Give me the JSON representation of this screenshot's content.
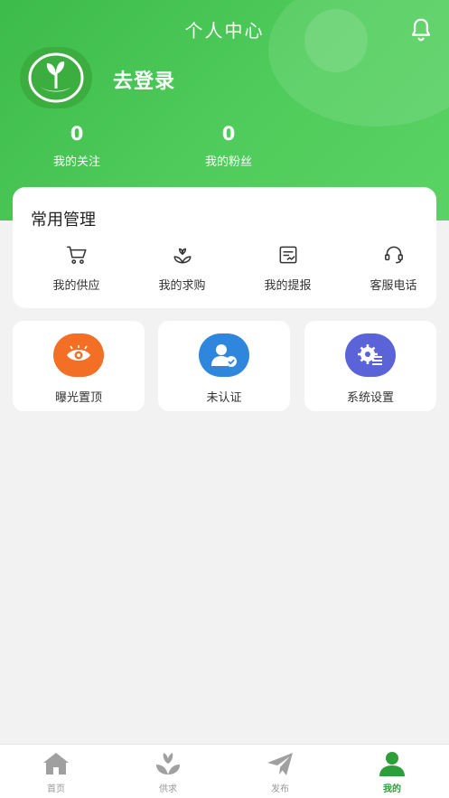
{
  "header": {
    "title": "个人中心",
    "login_label": "去登录",
    "stats": [
      {
        "value": "0",
        "label": "我的关注"
      },
      {
        "value": "0",
        "label": "我的粉丝"
      }
    ]
  },
  "common_management": {
    "title": "常用管理",
    "items": [
      {
        "label": "我的供应",
        "icon": "cart-icon"
      },
      {
        "label": "我的求购",
        "icon": "sprout-icon"
      },
      {
        "label": "我的提报",
        "icon": "report-icon"
      },
      {
        "label": "客服电话",
        "icon": "headset-icon"
      }
    ]
  },
  "tiles": [
    {
      "label": "曝光置顶",
      "icon": "eye-icon",
      "color": "#f36f25"
    },
    {
      "label": "未认证",
      "icon": "verified-user-icon",
      "color": "#2f86dd"
    },
    {
      "label": "系统设置",
      "icon": "settings-icon",
      "color": "#5a63d8"
    }
  ],
  "tabbar": {
    "items": [
      {
        "label": "首页",
        "icon": "home-icon",
        "active": false
      },
      {
        "label": "供求",
        "icon": "sprout-icon",
        "active": false
      },
      {
        "label": "发布",
        "icon": "send-icon",
        "active": false
      },
      {
        "label": "我的",
        "icon": "user-icon",
        "active": true
      }
    ]
  },
  "colors": {
    "header_green": "#4fcc5b",
    "active_tab": "#2e9e3a",
    "inactive_icon": "#a0a0a0"
  }
}
